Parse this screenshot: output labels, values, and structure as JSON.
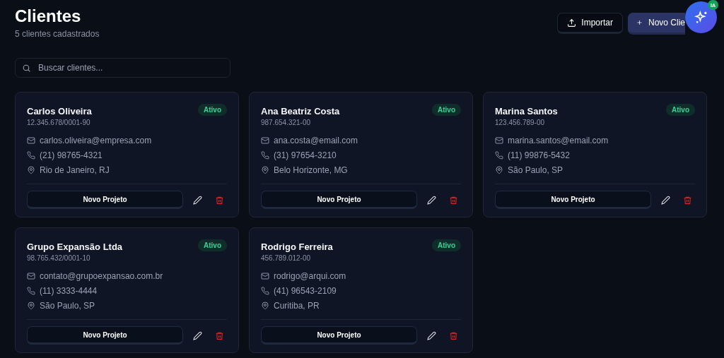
{
  "header": {
    "title": "Clientes",
    "subtitle": "5 clientes cadastrados",
    "import_button": "Importar",
    "new_button": "Novo Clie",
    "ai_badge": "IA"
  },
  "search": {
    "placeholder": "Buscar clientes..."
  },
  "clients": [
    {
      "name": "Carlos Oliveira",
      "document": "12.345.678/0001-90",
      "status": "Ativo",
      "email": "carlos.oliveira@empresa.com",
      "phone": "(21) 98765-4321",
      "location": "Rio de Janeiro, RJ",
      "action": "Novo Projeto"
    },
    {
      "name": "Ana Beatriz Costa",
      "document": "987.654.321-00",
      "status": "Ativo",
      "email": "ana.costa@email.com",
      "phone": "(31) 97654-3210",
      "location": "Belo Horizonte, MG",
      "action": "Novo Projeto"
    },
    {
      "name": "Marina Santos",
      "document": "123.456.789-00",
      "status": "Ativo",
      "email": "marina.santos@email.com",
      "phone": "(11) 99876-5432",
      "location": "São Paulo, SP",
      "action": "Novo Projeto"
    },
    {
      "name": "Grupo Expansão Ltda",
      "document": "98.765.432/0001-10",
      "status": "Ativo",
      "email": "contato@grupoexpansao.com.br",
      "phone": "(11) 3333-4444",
      "location": "São Paulo, SP",
      "action": "Novo Projeto"
    },
    {
      "name": "Rodrigo Ferreira",
      "document": "456.789.012-00",
      "status": "Ativo",
      "email": "rodrigo@arqui.com",
      "phone": "(41) 96543-2109",
      "location": "Curitiba, PR",
      "action": "Novo Projeto"
    }
  ]
}
